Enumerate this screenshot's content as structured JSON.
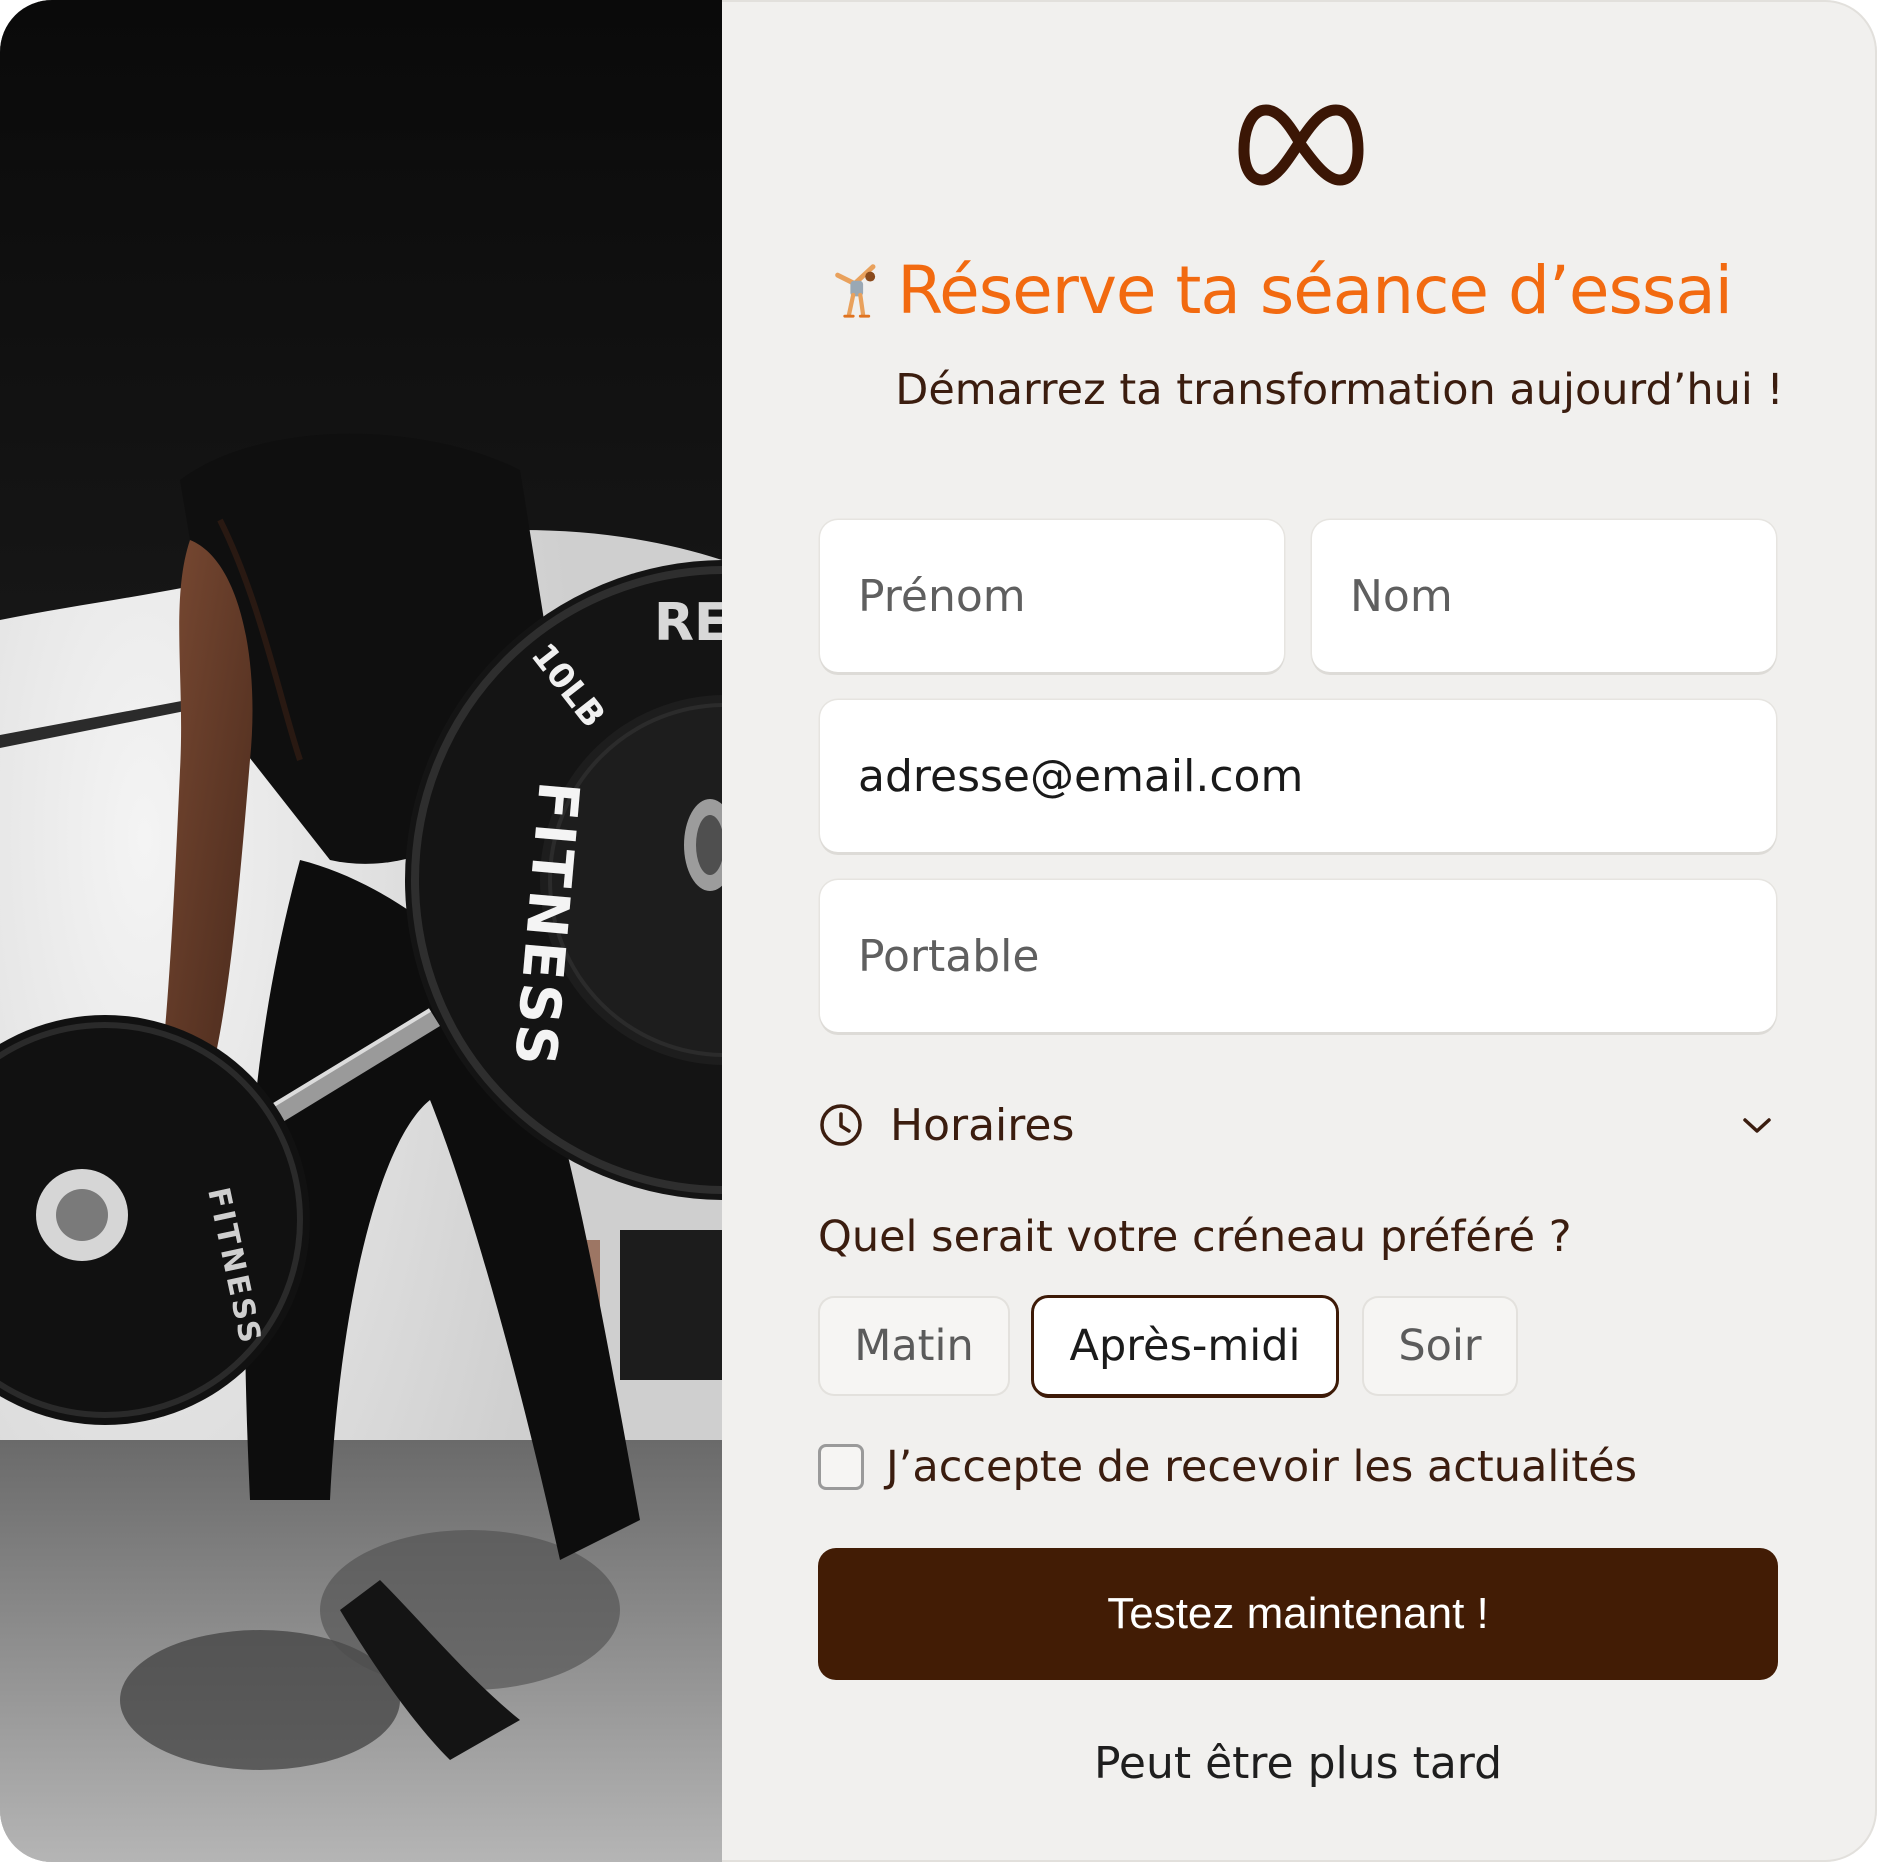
{
  "form": {
    "title": "Réserve ta séance d’essai",
    "subtitle": "Démarrez ta transformation aujourd’hui !",
    "fields": {
      "first_name_placeholder": "Prénom",
      "last_name_placeholder": "Nom",
      "email_value": "adresse@email.com",
      "phone_placeholder": "Portable"
    },
    "schedule": {
      "label": "Horaires",
      "question": "Quel serait votre créneau préféré ?",
      "options": [
        "Matin",
        "Après-midi",
        "Soir"
      ],
      "selected": "Après-midi"
    },
    "consent_label": "J’accepte de recevoir les actualités",
    "consent_checked": false,
    "submit_label": "Testez maintenant !",
    "later_label": "Peut être plus tard"
  },
  "photo": {
    "plate_text_large": "FITNESS",
    "plate_weight": "10LB",
    "plate_brand_partial": "RE",
    "plate_text_small": "FITNESS"
  },
  "colors": {
    "accent_orange": "#f26a10",
    "brand_brown": "#421c05",
    "text_brown": "#3b1d0f",
    "panel_bg": "#f1f0ee"
  },
  "icons": {
    "logo": "infinity-logo-icon",
    "title_emoji": "person-cartwheeling-icon",
    "schedule": "clock-icon",
    "expand": "chevron-down-icon"
  }
}
